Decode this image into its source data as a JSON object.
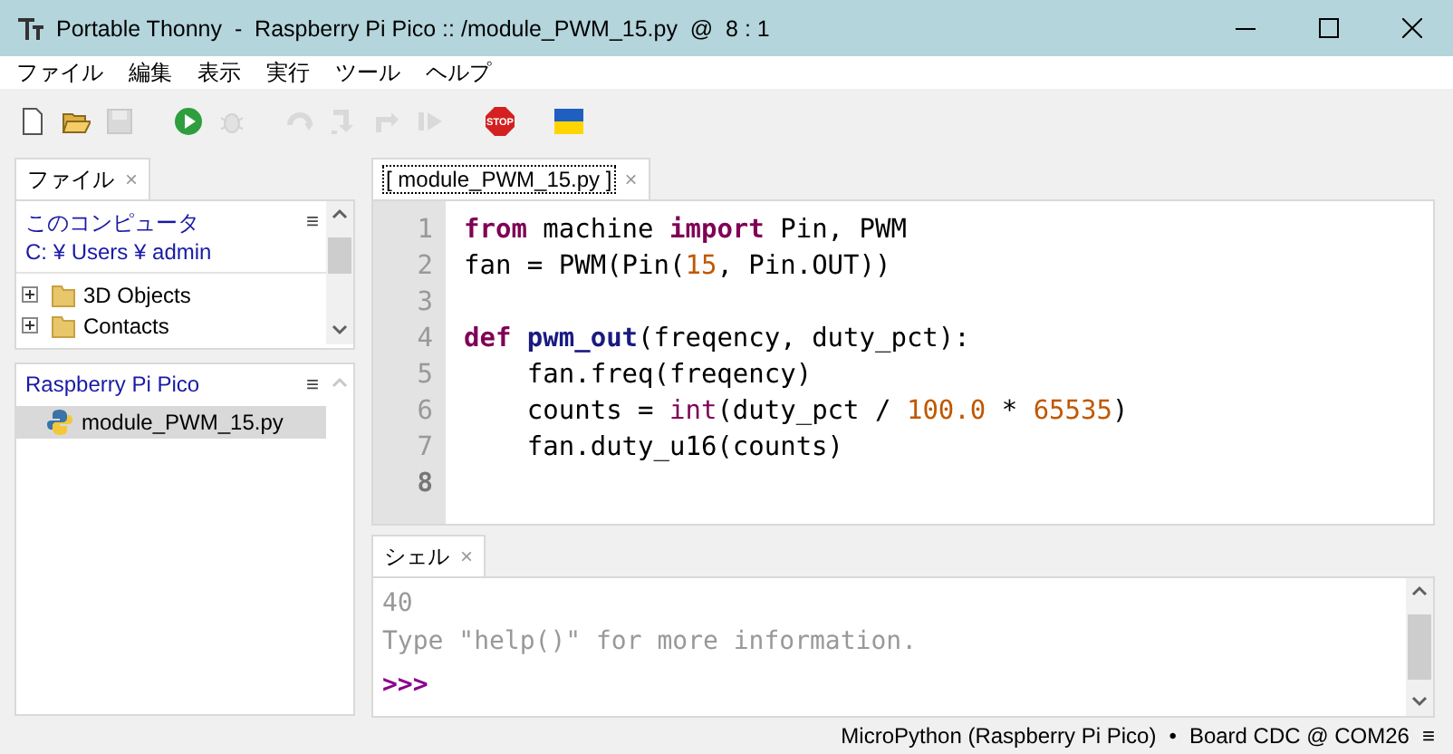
{
  "window": {
    "title": "Portable Thonny  -  Raspberry Pi Pico :: /module_PWM_15.py  @  8 : 1"
  },
  "menu": [
    "ファイル",
    "編集",
    "表示",
    "実行",
    "ツール",
    "ヘルプ"
  ],
  "toolbar": [
    {
      "kind": "new",
      "disabled": false
    },
    {
      "kind": "open",
      "disabled": false
    },
    {
      "kind": "save",
      "disabled": true
    },
    {
      "kind": "run",
      "disabled": false
    },
    {
      "kind": "debug",
      "disabled": true
    },
    {
      "kind": "step-over",
      "disabled": true
    },
    {
      "kind": "step-into",
      "disabled": true
    },
    {
      "kind": "step-out",
      "disabled": true
    },
    {
      "kind": "resume",
      "disabled": true
    },
    {
      "kind": "stop",
      "label": "STOP",
      "disabled": false
    },
    {
      "kind": "flag",
      "disabled": false
    }
  ],
  "files_panel": {
    "tab": {
      "label": "ファイル",
      "close": "×",
      "selected": true
    },
    "computer": {
      "title": "このコンピュータ",
      "path": "C: ¥ Users ¥ admin",
      "menu": "≡",
      "items": [
        {
          "name": "3D Objects",
          "expanded": false
        },
        {
          "name": "Contacts",
          "expanded": false
        }
      ]
    },
    "device": {
      "title": "Raspberry Pi Pico",
      "menu": "≡",
      "items": [
        {
          "name": "module_PWM_15.py",
          "selected": true
        }
      ]
    }
  },
  "editor": {
    "tab": {
      "label": "[ module_PWM_15.py ]",
      "close": "×",
      "selected": true
    },
    "lines": [
      {
        "number": "1",
        "current": false,
        "tokens": [
          {
            "text": "from",
            "kind": "keyword"
          },
          {
            "text": " machine ",
            "kind": "name"
          },
          {
            "text": "import",
            "kind": "keyword"
          },
          {
            "text": " Pin, PWM",
            "kind": "name"
          }
        ]
      },
      {
        "number": "2",
        "current": false,
        "tokens": [
          {
            "text": "fan = PWM(Pin(",
            "kind": "name"
          },
          {
            "text": "15",
            "kind": "number"
          },
          {
            "text": ", Pin.OUT))",
            "kind": "name"
          }
        ]
      },
      {
        "number": "3",
        "current": false
      },
      {
        "number": "4",
        "current": false,
        "tokens": [
          {
            "text": "def",
            "kind": "keyword"
          },
          {
            "text": " pwm_out",
            "kind": "defname"
          },
          {
            "text": "(freqency, duty_pct):",
            "kind": "name"
          }
        ]
      },
      {
        "number": "5",
        "current": false,
        "tokens": [
          {
            "text": "    fan.freq(freqency)",
            "kind": "name"
          }
        ]
      },
      {
        "number": "6",
        "current": false,
        "tokens": [
          {
            "text": "    counts = ",
            "kind": "name"
          },
          {
            "text": "int",
            "kind": "builtin"
          },
          {
            "text": "(duty_pct / ",
            "kind": "name"
          },
          {
            "text": "100.0",
            "kind": "number"
          },
          {
            "text": " * ",
            "kind": "name"
          },
          {
            "text": "65535",
            "kind": "number"
          },
          {
            "text": ")",
            "kind": "name"
          }
        ]
      },
      {
        "number": "7",
        "current": false,
        "tokens": [
          {
            "text": "    fan.duty_u16(counts)",
            "kind": "name"
          }
        ]
      },
      {
        "number": "8",
        "current": true
      }
    ]
  },
  "shell": {
    "tab": {
      "label": "シェル",
      "close": "×",
      "selected": true
    },
    "lines": [
      {
        "text": "40",
        "kind": "output"
      },
      {
        "text": "Type \"help()\" for more information.",
        "kind": "output"
      },
      {
        "text": ">>>",
        "kind": "prompt"
      }
    ]
  },
  "status_bar": {
    "interpreter": "MicroPython (Raspberry Pi Pico)",
    "separator": "•",
    "port": "Board CDC @ COM26",
    "menu": "≡"
  }
}
